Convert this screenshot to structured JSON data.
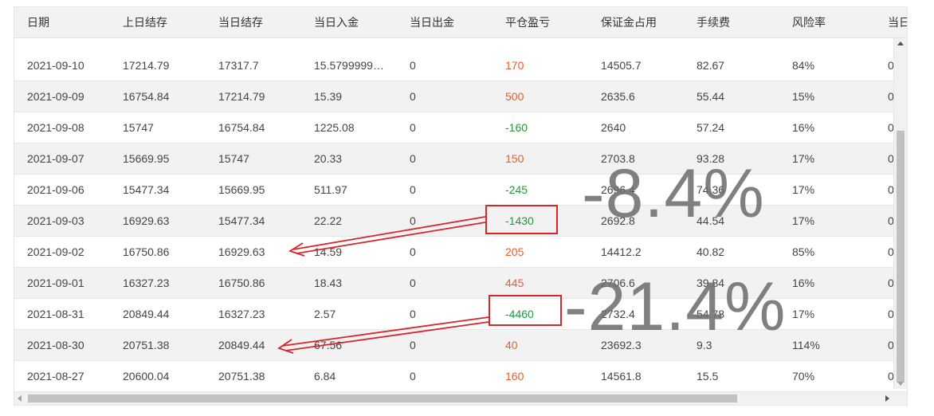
{
  "columns": [
    {
      "key": "date",
      "label": "日期"
    },
    {
      "key": "prev_balance",
      "label": "上日结存"
    },
    {
      "key": "balance",
      "label": "当日结存"
    },
    {
      "key": "deposit",
      "label": "当日入金"
    },
    {
      "key": "withdrawal",
      "label": "当日出金"
    },
    {
      "key": "close_pnl",
      "label": "平仓盈亏"
    },
    {
      "key": "margin",
      "label": "保证金占用"
    },
    {
      "key": "fee",
      "label": "手续费"
    },
    {
      "key": "risk",
      "label": "风险率"
    },
    {
      "key": "next",
      "label": "当日"
    }
  ],
  "rows": [
    {
      "date": "2021-09-10",
      "prev_balance": "17214.79",
      "balance": "17317.7",
      "deposit": "15.5799999…",
      "withdrawal": "0",
      "close_pnl": "170",
      "pnl_sign": "pos",
      "margin": "14505.7",
      "fee": "82.67",
      "risk": "84%",
      "next": "0"
    },
    {
      "date": "2021-09-09",
      "prev_balance": "16754.84",
      "balance": "17214.79",
      "deposit": "15.39",
      "withdrawal": "0",
      "close_pnl": "500",
      "pnl_sign": "pos",
      "margin": "2635.6",
      "fee": "55.44",
      "risk": "15%",
      "next": "0"
    },
    {
      "date": "2021-09-08",
      "prev_balance": "15747",
      "balance": "16754.84",
      "deposit": "1225.08",
      "withdrawal": "0",
      "close_pnl": "-160",
      "pnl_sign": "neg",
      "margin": "2640",
      "fee": "57.24",
      "risk": "16%",
      "next": "0"
    },
    {
      "date": "2021-09-07",
      "prev_balance": "15669.95",
      "balance": "15747",
      "deposit": "20.33",
      "withdrawal": "0",
      "close_pnl": "150",
      "pnl_sign": "pos",
      "margin": "2703.8",
      "fee": "93.28",
      "risk": "17%",
      "next": "0"
    },
    {
      "date": "2021-09-06",
      "prev_balance": "15477.34",
      "balance": "15669.95",
      "deposit": "511.97",
      "withdrawal": "0",
      "close_pnl": "-245",
      "pnl_sign": "neg",
      "margin": "2696.4",
      "fee": "74.36",
      "risk": "17%",
      "next": "0"
    },
    {
      "date": "2021-09-03",
      "prev_balance": "16929.63",
      "balance": "15477.34",
      "deposit": "22.22",
      "withdrawal": "0",
      "close_pnl": "-1430",
      "pnl_sign": "neg",
      "margin": "2692.8",
      "fee": "44.54",
      "risk": "17%",
      "next": "0"
    },
    {
      "date": "2021-09-02",
      "prev_balance": "16750.86",
      "balance": "16929.63",
      "deposit": "14.59",
      "withdrawal": "0",
      "close_pnl": "205",
      "pnl_sign": "pos",
      "margin": "14412.2",
      "fee": "40.82",
      "risk": "85%",
      "next": "0"
    },
    {
      "date": "2021-09-01",
      "prev_balance": "16327.23",
      "balance": "16750.86",
      "deposit": "18.43",
      "withdrawal": "0",
      "close_pnl": "445",
      "pnl_sign": "pos",
      "margin": "2706.6",
      "fee": "39.84",
      "risk": "16%",
      "next": "0"
    },
    {
      "date": "2021-08-31",
      "prev_balance": "20849.44",
      "balance": "16327.23",
      "deposit": "2.57",
      "withdrawal": "0",
      "close_pnl": "-4460",
      "pnl_sign": "neg",
      "margin": "2732.4",
      "fee": "54.78",
      "risk": "17%",
      "next": "0"
    },
    {
      "date": "2021-08-30",
      "prev_balance": "20751.38",
      "balance": "20849.44",
      "deposit": "67.56",
      "withdrawal": "0",
      "close_pnl": "40",
      "pnl_sign": "pos",
      "margin": "23692.3",
      "fee": "9.3",
      "risk": "114%",
      "next": "0"
    },
    {
      "date": "2021-08-27",
      "prev_balance": "20600.04",
      "balance": "20751.38",
      "deposit": "6.84",
      "withdrawal": "0",
      "close_pnl": "160",
      "pnl_sign": "pos",
      "margin": "14561.8",
      "fee": "15.5",
      "risk": "70%",
      "next": "0"
    }
  ],
  "annotations": {
    "overlay_1": "-8.4%",
    "overlay_2": "-21.4%",
    "highlight_color": "#d9262b"
  },
  "colors": {
    "pnl_positive": "#f05a2a",
    "pnl_negative": "#1f9a3a",
    "header_bg": "#f2f2f2",
    "row_alt_bg": "#f2f2f2"
  }
}
